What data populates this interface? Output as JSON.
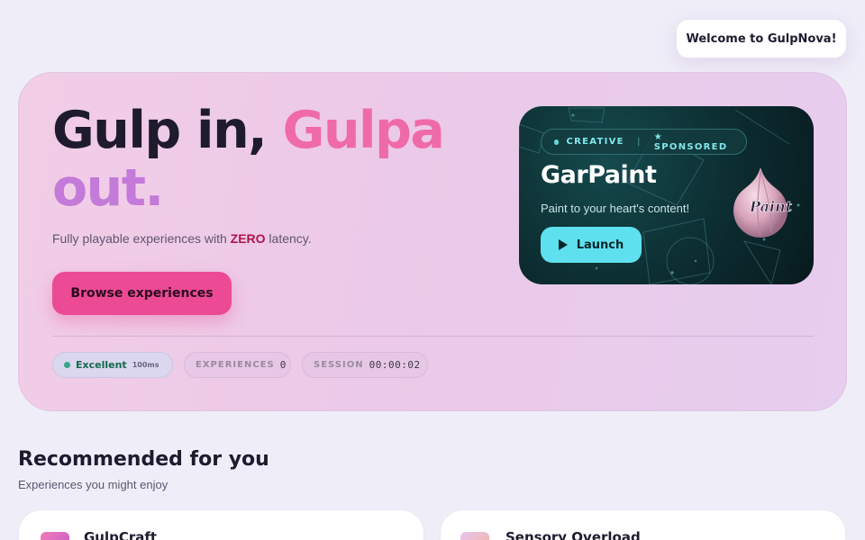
{
  "header": {
    "welcome": "Welcome to GulpNova!"
  },
  "hero": {
    "title_part1": "Gulp in, ",
    "title_part2": "Gulpa",
    "title_part3": "out.",
    "subtitle_prefix": "Fully playable experiences with ",
    "subtitle_emphasis": "ZERO",
    "subtitle_suffix": " latency.",
    "cta_label": "Browse experiences",
    "stats": {
      "connection_label": "Excellent",
      "connection_latency": "100ms",
      "experiences_label": "EXPERIENCES",
      "experiences_count": "0",
      "session_label": "SESSION",
      "session_time": "00:00:02"
    }
  },
  "featured": {
    "tag1": "CREATIVE",
    "tag2": "★ SPONSORED",
    "title": "GarPaint",
    "description": "Paint to your heart's content!",
    "launch_label": "Launch",
    "logo_text": "Paint"
  },
  "recommended": {
    "title": "Recommended for you",
    "subtitle": "Experiences you might enjoy",
    "items": [
      {
        "name": "GulpCraft"
      },
      {
        "name": "Sensory Overload"
      }
    ]
  },
  "colors": {
    "accent_pink": "#ec4a95",
    "accent_cyan": "#5fe0ee",
    "status_green": "#35a88a"
  }
}
